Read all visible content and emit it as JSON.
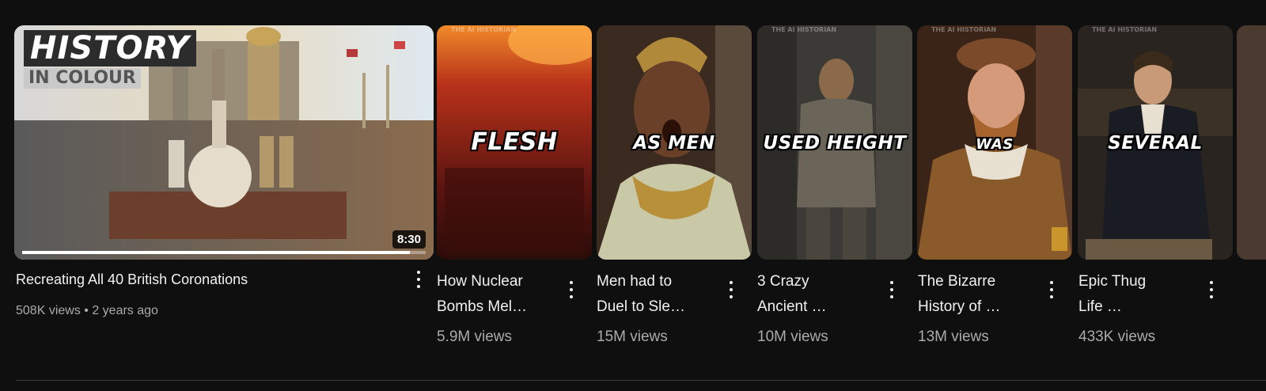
{
  "videos": [
    {
      "title": "Recreating All 40 British Coronations",
      "views": "508K views",
      "age": "2 years ago",
      "duration": "8:30",
      "banner_line1": "HISTORY",
      "banner_line2": "IN COLOUR",
      "progress": 0.96
    },
    {
      "title_line1": "How Nuclear",
      "title_line2": "Bombs Mel…",
      "views": "5.9M views",
      "overlay": "FLESH",
      "watermark": "THE AI HISTORIAN"
    },
    {
      "title_line1": "Men had to",
      "title_line2": "Duel to Sle…",
      "views": "15M views",
      "overlay": "AS MEN"
    },
    {
      "title_line1": "3 Crazy",
      "title_line2": "Ancient …",
      "views": "10M views",
      "overlay": "USED HEIGHT",
      "watermark": "THE AI HISTORIAN"
    },
    {
      "title_line1": "The Bizarre",
      "title_line2": "History of …",
      "views": "13M views",
      "overlay": "WAS",
      "watermark": "THE AI HISTORIAN"
    },
    {
      "title_line1": "Epic Thug",
      "title_line2": "Life …",
      "views": "433K views",
      "overlay": "SEVERAL",
      "watermark": "THE AI HISTORIAN"
    }
  ],
  "colors": {
    "background": "#0f0f0f",
    "text": "#f1f1f1",
    "secondary_text": "#aaaaaa"
  }
}
